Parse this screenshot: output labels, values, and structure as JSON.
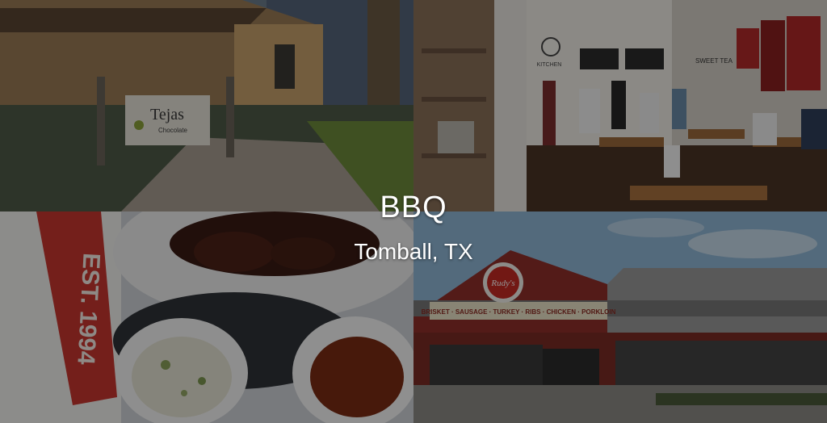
{
  "caption": {
    "title": "BBQ",
    "location": "Tomball, TX"
  },
  "photos": {
    "storefront": {
      "sign_text": "Tejas",
      "sign_subtext": "Chocolate"
    },
    "interior": {
      "kitchen_sign": "KITCHEN",
      "sweet_tea_sign": "SWEET TEA"
    },
    "plate": {
      "napkin_text": "EST. 1994"
    },
    "restaurant_exterior": {
      "logo_text": "Rudy's",
      "banner_text": "BRISKET · SAUSAGE · TURKEY · RIBS · CHICKEN · PORKLOIN"
    }
  },
  "colors": {
    "overlay": "#000000",
    "caption_text": "#ffffff"
  }
}
